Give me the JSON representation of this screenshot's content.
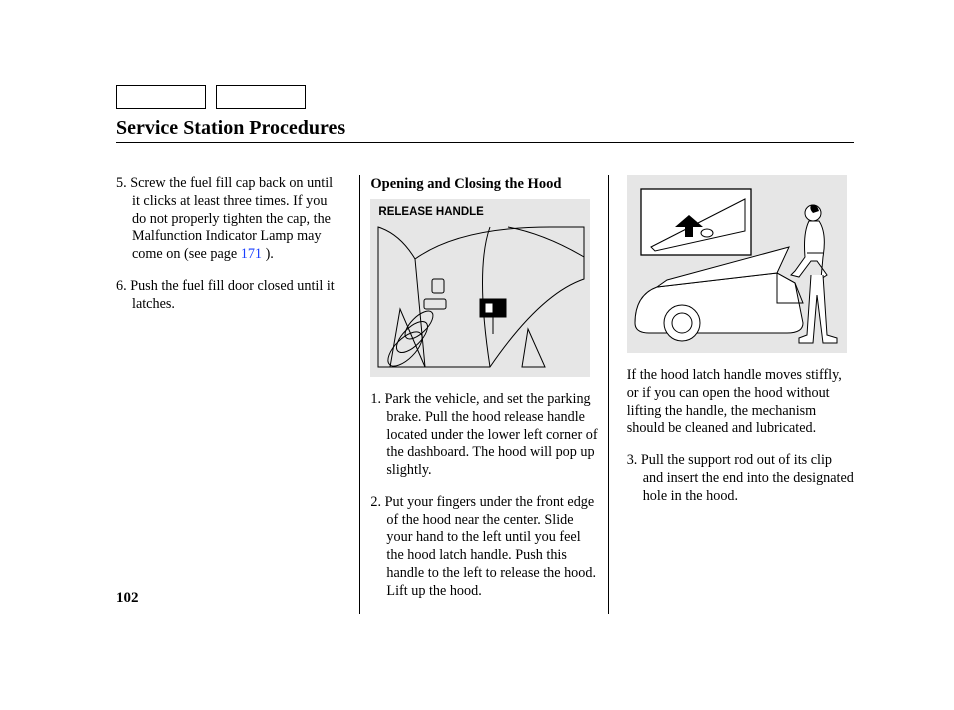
{
  "title": "Service Station Procedures",
  "page_number": "102",
  "col1": {
    "step5_num": "5.",
    "step5": "Screw the fuel fill cap back on until it clicks at least three times. If you do not properly tighten the cap, the Malfunction Indicator Lamp may come on (see page",
    "step5_link": "171",
    "step5_after": " ).",
    "step6_num": "6.",
    "step6": "Push the fuel fill door closed until it latches."
  },
  "col2": {
    "subhead": "Opening and Closing the Hood",
    "illus_label": "RELEASE HANDLE",
    "step1_num": "1.",
    "step1": "Park the vehicle, and set the parking brake. Pull the hood release handle located under the lower left corner of the dashboard. The hood will pop up slightly.",
    "step2_num": "2.",
    "step2": "Put your fingers under the front edge of the hood near the center. Slide your hand to the left until you feel the hood latch handle. Push this handle to the left to release the hood. Lift up the hood."
  },
  "col3": {
    "para1": "If the hood latch handle moves stiffly, or if you can open the hood without lifting the handle, the mechanism should be cleaned and lubricated.",
    "step3_num": "3.",
    "step3": "Pull the support rod out of its clip and insert the end into the designated hole in the hood."
  }
}
